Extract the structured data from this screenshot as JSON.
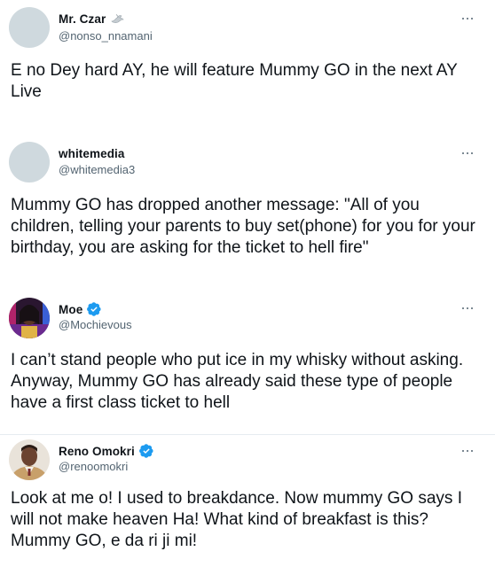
{
  "tweets": [
    {
      "name": "Mr. Czar",
      "handle": "@nonso_nnamani",
      "name_icon": "dove-icon",
      "verified": false,
      "text": "E no Dey hard AY, he will feature Mummy GO in the next AY Live"
    },
    {
      "name": "whitemedia",
      "handle": "@whitemedia3",
      "verified": false,
      "text": "Mummy GO has dropped another message: \"All of you children, telling your parents to buy set(phone) for you for your birthday, you are asking for the ticket to hell fire\""
    },
    {
      "name": "Moe",
      "handle": "@Mochievous",
      "verified": true,
      "text": "I can’t stand people who put ice in my whisky without asking. Anyway, Mummy GO has already said these type of people have a first class ticket to hell"
    },
    {
      "name": "Reno Omokri",
      "handle": "@renoomokri",
      "verified": true,
      "text": "Look at me o! I used to breakdance. Now mummy GO says I will not make heaven Ha! What kind of breakfast is this? Mummy GO, e da ri ji mi!"
    }
  ],
  "colors": {
    "verified_blue": "#1d9bf0",
    "text_primary": "#0f1419",
    "text_secondary": "#536471",
    "avatar_placeholder": "#cfd9de"
  }
}
